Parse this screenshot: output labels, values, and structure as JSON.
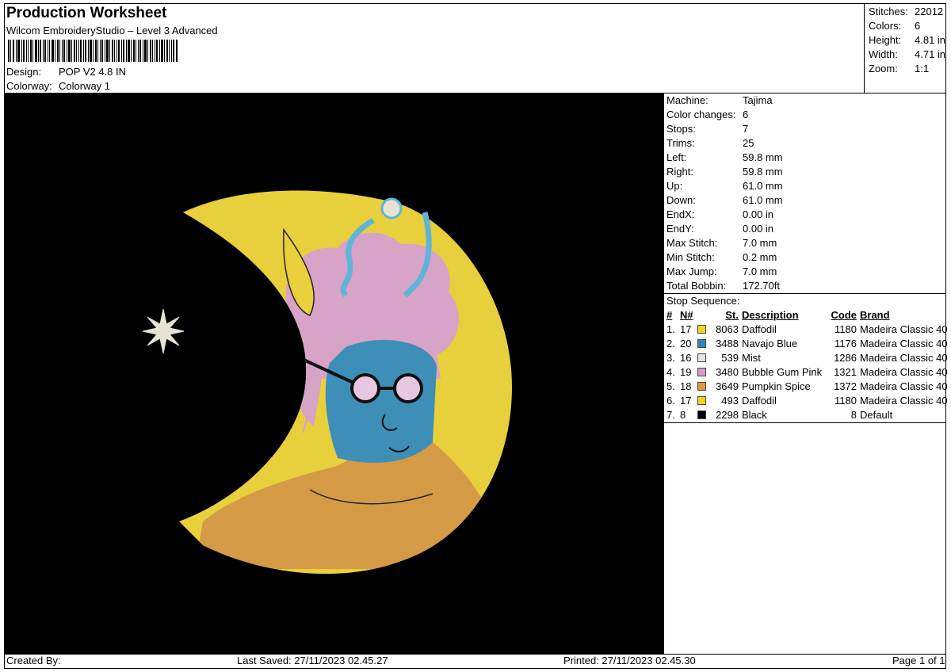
{
  "header": {
    "title": "Production Worksheet",
    "software": "Wilcom EmbroideryStudio – Level 3 Advanced",
    "design_label": "Design:",
    "design_value": "POP V2 4.8 IN",
    "colorway_label": "Colorway:",
    "colorway_value": "Colorway 1"
  },
  "summary": [
    {
      "label": "Stitches:",
      "value": "22012"
    },
    {
      "label": "Colors:",
      "value": "6"
    },
    {
      "label": "Height:",
      "value": "4.81 in"
    },
    {
      "label": "Width:",
      "value": "4.71 in"
    },
    {
      "label": "Zoom:",
      "value": "1:1"
    }
  ],
  "machine_info": [
    {
      "label": "Machine:",
      "value": "Tajima"
    },
    {
      "label": "Color changes:",
      "value": "6"
    },
    {
      "label": "Stops:",
      "value": "7"
    },
    {
      "label": "Trims:",
      "value": "25"
    },
    {
      "label": "Left:",
      "value": "59.8 mm"
    },
    {
      "label": "Right:",
      "value": "59.8 mm"
    },
    {
      "label": "Up:",
      "value": "61.0 mm"
    },
    {
      "label": "Down:",
      "value": "61.0 mm"
    },
    {
      "label": "EndX:",
      "value": "0.00 in"
    },
    {
      "label": "EndY:",
      "value": "0.00 in"
    },
    {
      "label": "Max Stitch:",
      "value": "7.0 mm"
    },
    {
      "label": "Min Stitch:",
      "value": "0.2 mm"
    },
    {
      "label": "Max Jump:",
      "value": "7.0 mm"
    },
    {
      "label": "Total Bobbin:",
      "value": "172.70ft"
    }
  ],
  "stop_sequence": {
    "title": "Stop Sequence:",
    "headers": [
      "#",
      "N#",
      "St.",
      "Description",
      "Code",
      "Brand"
    ],
    "rows": [
      {
        "num": "1.",
        "n": "17",
        "color": "#f5d31e",
        "st": "8063",
        "desc": "Daffodil",
        "code": "1180",
        "brand": "Madeira Classic 40"
      },
      {
        "num": "2.",
        "n": "20",
        "color": "#2f86c2",
        "st": "3488",
        "desc": "Navajo Blue",
        "code": "1176",
        "brand": "Madeira Classic 40"
      },
      {
        "num": "3.",
        "n": "16",
        "color": "#e4e4e0",
        "st": "539",
        "desc": "Mist",
        "code": "1286",
        "brand": "Madeira Classic 40"
      },
      {
        "num": "4.",
        "n": "19",
        "color": "#d89ac6",
        "st": "3480",
        "desc": "Bubble Gum Pink",
        "code": "1321",
        "brand": "Madeira Classic 40"
      },
      {
        "num": "5.",
        "n": "18",
        "color": "#dd9a3c",
        "st": "3649",
        "desc": "Pumpkin Spice",
        "code": "1372",
        "brand": "Madeira Classic 40"
      },
      {
        "num": "6.",
        "n": "17",
        "color": "#f5d31e",
        "st": "493",
        "desc": "Daffodil",
        "code": "1180",
        "brand": "Madeira Classic 40"
      },
      {
        "num": "7.",
        "n": "8",
        "color": "#000000",
        "st": "2298",
        "desc": "Black",
        "code": "8",
        "brand": "Default"
      }
    ]
  },
  "footer": {
    "created_by": "Created By:",
    "last_saved": "Last Saved: 27/11/2023 02.45.27",
    "printed": "Printed: 27/11/2023 02.45.30",
    "page": "Page 1 of 1"
  },
  "design_colors": {
    "moon": "#e8cf3c",
    "skin": "#3d8fb8",
    "hair": "#d7a3c7",
    "sweater": "#d49a45",
    "background": "#000000"
  }
}
